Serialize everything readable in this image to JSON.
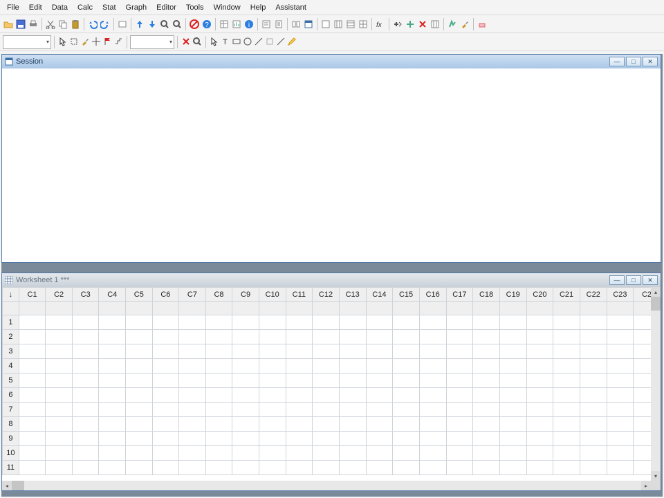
{
  "menubar": {
    "items": [
      "File",
      "Edit",
      "Data",
      "Calc",
      "Stat",
      "Graph",
      "Editor",
      "Tools",
      "Window",
      "Help",
      "Assistant"
    ]
  },
  "toolbar1": {
    "icons": [
      "open-icon",
      "save-icon",
      "print-icon",
      "sep",
      "cut-icon",
      "copy-icon",
      "paste-icon",
      "sep",
      "undo-icon",
      "redo-icon",
      "sep",
      "prev-cmd-icon",
      "sep",
      "up-arrow-icon",
      "down-arrow-icon",
      "find-icon",
      "find-next-icon",
      "sep",
      "cancel-icon",
      "help-icon",
      "sep",
      "show-worksheets-icon",
      "show-graphs-icon",
      "show-info-icon",
      "sep",
      "show-history-icon",
      "show-reportpad-icon",
      "sep",
      "project-manager-icon",
      "show-session-icon",
      "sep",
      "options-win-icon",
      "columns-icon",
      "rows-icon",
      "cells-icon",
      "sep",
      "fx-icon",
      "sep",
      "assign-formula-icon",
      "insert-cell-icon",
      "clear-cell-icon",
      "move-columns-icon",
      "sep",
      "last-dialog-icon",
      "brush-icon",
      "sep",
      "eraser-icon"
    ]
  },
  "toolbar2": {
    "combo1_value": "",
    "combo2_value": "",
    "icons_left": [
      "select-pointer-icon",
      "select-area-icon",
      "brush-small-icon",
      "crosshair-icon",
      "flag-icon",
      "step-icon"
    ],
    "icons_mid": [
      "delete-icon",
      "zoom-icon"
    ],
    "icons_right": [
      "pointer2-icon",
      "text-tool-icon",
      "rect-tool-icon",
      "circle-tool-icon",
      "line-tool-icon",
      "blank-icon",
      "polyline-tool-icon",
      "marker-tool-icon"
    ]
  },
  "session_window": {
    "title": "Session"
  },
  "worksheet_window": {
    "title": "Worksheet 1 ***",
    "corner": "↓",
    "columns": [
      "C1",
      "C2",
      "C3",
      "C4",
      "C5",
      "C6",
      "C7",
      "C8",
      "C9",
      "C10",
      "C11",
      "C12",
      "C13",
      "C14",
      "C15",
      "C16",
      "C17",
      "C18",
      "C19",
      "C20",
      "C21",
      "C22",
      "C23",
      "C2"
    ],
    "rows": [
      "1",
      "2",
      "3",
      "4",
      "5",
      "6",
      "7",
      "8",
      "9",
      "10",
      "11"
    ]
  }
}
